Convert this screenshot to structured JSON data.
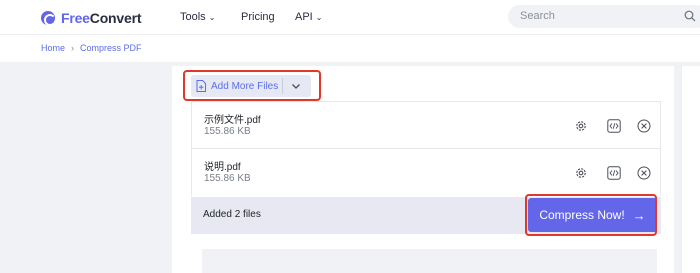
{
  "header": {
    "logo_free": "Free",
    "logo_convert": "Convert",
    "nav": [
      {
        "label": "Tools",
        "has_dropdown": true
      },
      {
        "label": "Pricing",
        "has_dropdown": false
      },
      {
        "label": "API",
        "has_dropdown": true
      }
    ],
    "search_placeholder": "Search"
  },
  "breadcrumb": {
    "home": "Home",
    "current": "Compress PDF"
  },
  "toolbar": {
    "add_more_files": "Add More Files"
  },
  "files": [
    {
      "name": "示例文件.pdf",
      "size": "155.86 KB"
    },
    {
      "name": "说明.pdf",
      "size": "155.86 KB"
    }
  ],
  "status": {
    "added_text": "Added 2 files"
  },
  "actions": {
    "compress_label": "Compress Now!"
  },
  "colors": {
    "accent": "#6366e8",
    "highlight_border": "#e0392b"
  }
}
